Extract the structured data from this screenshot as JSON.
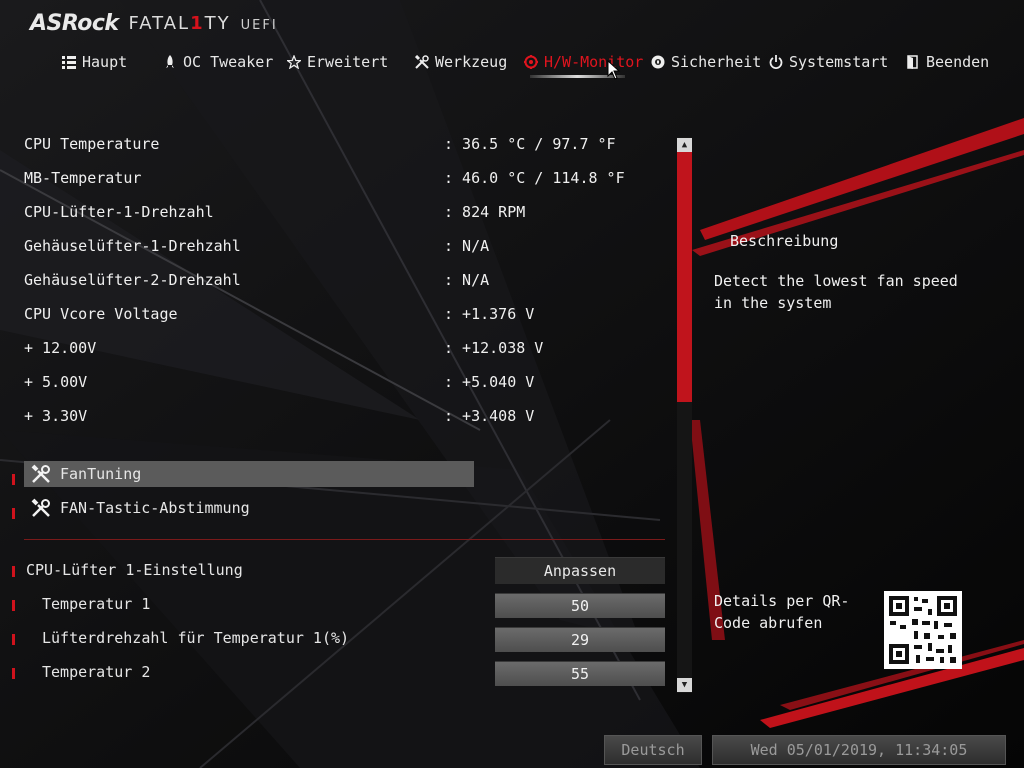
{
  "brand": {
    "asrock": "ASRock",
    "fatal_prefix": "FATAL",
    "fatal_one": "1",
    "fatal_suffix": "TY",
    "uefi": "UEFI"
  },
  "nav": {
    "tabs": [
      {
        "label": "Haupt",
        "icon": "list-icon"
      },
      {
        "label": "OC Tweaker",
        "icon": "rocket-icon"
      },
      {
        "label": "Erweitert",
        "icon": "star-icon"
      },
      {
        "label": "Werkzeug",
        "icon": "tools-icon"
      },
      {
        "label": "H/W-Monitor",
        "icon": "monitor-gear-icon",
        "active": true
      },
      {
        "label": "Sicherheit",
        "icon": "shield-icon"
      },
      {
        "label": "Systemstart",
        "icon": "power-icon"
      },
      {
        "label": "Beenden",
        "icon": "exit-door-icon"
      }
    ]
  },
  "readings": [
    {
      "label": "CPU Temperature",
      "value": ": 36.5 °C /  97.7 °F"
    },
    {
      "label": "MB-Temperatur",
      "value": ": 46.0 °C / 114.8 °F"
    },
    {
      "label": "CPU-Lüfter-1-Drehzahl",
      "value": ": 824 RPM"
    },
    {
      "label": "Gehäuselüfter-1-Drehzahl",
      "value": ": N/A"
    },
    {
      "label": "Gehäuselüfter-2-Drehzahl",
      "value": ": N/A"
    },
    {
      "label": "CPU Vcore Voltage",
      "value": ": +1.376 V"
    },
    {
      "label": "+ 12.00V",
      "value": ": +12.038 V"
    },
    {
      "label": "+ 5.00V",
      "value": ": +5.040 V"
    },
    {
      "label": "+ 3.30V",
      "value": ": +3.408 V"
    }
  ],
  "menu": [
    {
      "label": "FanTuning",
      "icon": "tools-icon",
      "selected": true
    },
    {
      "label": "FAN-Tastic-Abstimmung",
      "icon": "tools-icon",
      "selected": false
    }
  ],
  "settings": [
    {
      "label": "CPU-Lüfter 1-Einstellung",
      "value": "Anpassen"
    },
    {
      "label": "Temperatur 1",
      "value": "50"
    },
    {
      "label": "Lüfterdrehzahl für Temperatur 1(%)",
      "value": "29"
    },
    {
      "label": "Temperatur 2",
      "value": "55"
    }
  ],
  "description": {
    "title": "Beschreibung",
    "text": "Detect the lowest fan speed in the system",
    "qr_text": "Details per QR-Code abrufen"
  },
  "footer": {
    "language": "Deutsch",
    "datetime": "Wed 05/01/2019, 11:34:05"
  },
  "colors": {
    "accent": "#d6121c",
    "selected_row": "#5b5b5b",
    "background": "#0b0b0c"
  }
}
